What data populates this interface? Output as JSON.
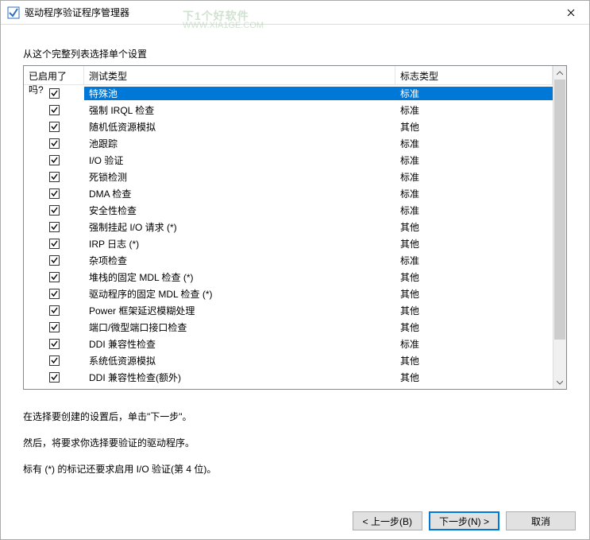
{
  "window": {
    "title": "驱动程序验证程序管理器"
  },
  "watermark": {
    "line1": "下1个好软件",
    "line2": "WWW.XIA1GE.COM"
  },
  "content": {
    "listLabel": "从这个完整列表选择单个设置",
    "columns": {
      "enabled": "已启用了吗?",
      "testType": "测试类型",
      "flagType": "标志类型"
    },
    "rows": [
      {
        "enabled": true,
        "test": "特殊池",
        "flag": "标准",
        "selected": true
      },
      {
        "enabled": true,
        "test": "强制 IRQL 检查",
        "flag": "标准"
      },
      {
        "enabled": true,
        "test": "随机低资源模拟",
        "flag": "其他"
      },
      {
        "enabled": true,
        "test": "池跟踪",
        "flag": "标准"
      },
      {
        "enabled": true,
        "test": "I/O 验证",
        "flag": "标准"
      },
      {
        "enabled": true,
        "test": "死锁检测",
        "flag": "标准"
      },
      {
        "enabled": true,
        "test": "DMA 检查",
        "flag": "标准"
      },
      {
        "enabled": true,
        "test": "安全性检查",
        "flag": "标准"
      },
      {
        "enabled": true,
        "test": "强制挂起 I/O 请求 (*)",
        "flag": "其他"
      },
      {
        "enabled": true,
        "test": "IRP 日志 (*)",
        "flag": "其他"
      },
      {
        "enabled": true,
        "test": "杂项检查",
        "flag": "标准"
      },
      {
        "enabled": true,
        "test": "堆栈的固定 MDL 检查 (*)",
        "flag": "其他"
      },
      {
        "enabled": true,
        "test": "驱动程序的固定 MDL 检查 (*)",
        "flag": "其他"
      },
      {
        "enabled": true,
        "test": "Power 框架延迟模糊处理",
        "flag": "其他"
      },
      {
        "enabled": true,
        "test": "端口/微型端口接口检查",
        "flag": "其他"
      },
      {
        "enabled": true,
        "test": "DDI 兼容性检查",
        "flag": "标准"
      },
      {
        "enabled": true,
        "test": "系统低资源模拟",
        "flag": "其他"
      },
      {
        "enabled": true,
        "test": "DDI 兼容性检查(额外)",
        "flag": "其他"
      }
    ],
    "note1": "在选择要创建的设置后，单击\"下一步\"。",
    "note2": "然后，将要求你选择要验证的驱动程序。",
    "note3": "标有 (*) 的标记还要求启用 I/O 验证(第 4 位)。"
  },
  "buttons": {
    "back": "< 上一步(B)",
    "next": "下一步(N) >",
    "cancel": "取消"
  }
}
